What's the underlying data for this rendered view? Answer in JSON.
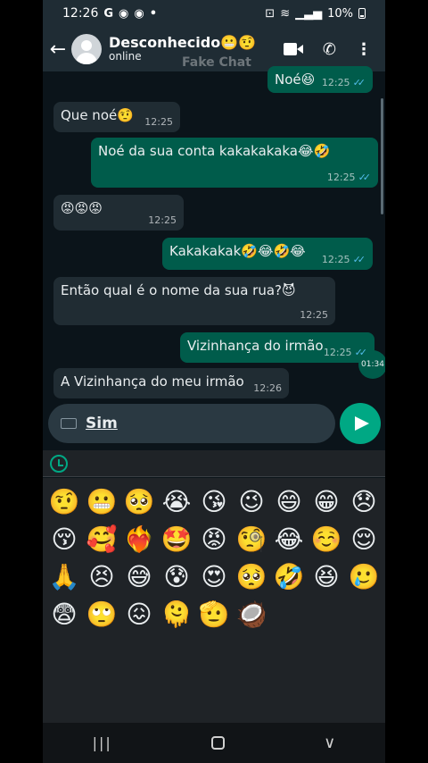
{
  "status_bar": {
    "time": "12:26",
    "icons_left": [
      "G",
      "◉",
      "◉",
      "•"
    ],
    "battery": "10%"
  },
  "header": {
    "back_icon": "←",
    "contact_name": "Desconhecido😬🤨",
    "contact_status": "online",
    "watermark": "Fake Chat"
  },
  "messages": [
    {
      "dir": "out",
      "text": "Noé😆",
      "time": "12:25"
    },
    {
      "dir": "in",
      "text": "Que noé🤨",
      "time": "12:25"
    },
    {
      "dir": "out",
      "text": "Noé da sua conta kakakakaka😂🤣",
      "time": "12:25"
    },
    {
      "dir": "in",
      "text": "😡😡😡",
      "time": "12:25"
    },
    {
      "dir": "out",
      "text": "Kakakakak🤣😂🤣😂",
      "time": "12:25"
    },
    {
      "dir": "in",
      "text": "Então qual é o nome da sua rua?😈",
      "time": "12:25"
    },
    {
      "dir": "out",
      "text": "Vizinhança do irmão",
      "time": "12:25"
    },
    {
      "dir": "in",
      "text": "A Vizinhança do meu irmão",
      "time": "12:26"
    }
  ],
  "date_pill": "01:34",
  "composer": {
    "value": "Sim"
  },
  "emojis": [
    "🤨",
    "😬",
    "🥺",
    "😭",
    "😘",
    "😉",
    "😄",
    "😁",
    "😞",
    "😚",
    "🥰",
    "❤️‍🔥",
    "🤩",
    "😡",
    "🧐",
    "😂",
    "☺️",
    "😌",
    "🙏",
    "😣",
    "😅",
    "😰",
    "😍",
    "🥺",
    "🤣",
    "😆",
    "🥲",
    "😨",
    "🙄",
    "😖",
    "🫠",
    "🫡",
    "🥥"
  ],
  "nav": {
    "recent": "|||",
    "back": "∨"
  },
  "colors": {
    "header": "#1f2c34",
    "chat_bg": "#0b141a",
    "incoming": "#202c33",
    "outgoing": "#005c4b",
    "accent": "#00a884",
    "read_ticks": "#53bdeb"
  }
}
